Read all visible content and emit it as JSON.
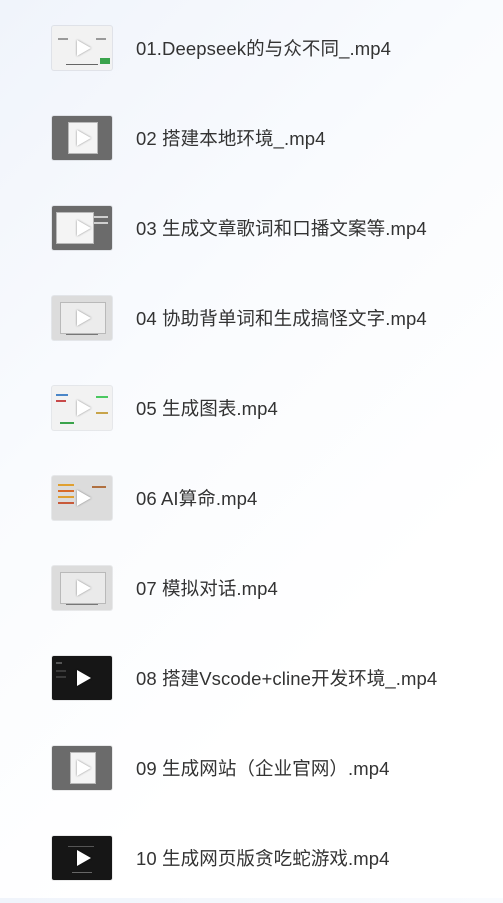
{
  "files": [
    {
      "name": "01.Deepseek的与众不同_.mp4",
      "thumb_icon": "play-icon",
      "thumb_style": "light-white"
    },
    {
      "name": "02 搭建本地环境_.mp4",
      "thumb_icon": "play-icon",
      "thumb_style": "gray"
    },
    {
      "name": "03 生成文章歌词和口播文案等.mp4",
      "thumb_icon": "play-icon",
      "thumb_style": "gray"
    },
    {
      "name": "04 协助背单词和生成搞怪文字.mp4",
      "thumb_icon": "play-icon",
      "thumb_style": "light"
    },
    {
      "name": "05 生成图表.mp4",
      "thumb_icon": "play-icon",
      "thumb_style": "light-white"
    },
    {
      "name": "06 AI算命.mp4",
      "thumb_icon": "play-icon",
      "thumb_style": "light"
    },
    {
      "name": "07 模拟对话.mp4",
      "thumb_icon": "play-icon",
      "thumb_style": "light"
    },
    {
      "name": "08 搭建Vscode+cline开发环境_.mp4",
      "thumb_icon": "play-icon",
      "thumb_style": "dark"
    },
    {
      "name": "09 生成网站（企业官网）.mp4",
      "thumb_icon": "play-icon",
      "thumb_style": "gray"
    },
    {
      "name": "10 生成网页版贪吃蛇游戏.mp4",
      "thumb_icon": "play-icon",
      "thumb_style": "dark"
    }
  ]
}
